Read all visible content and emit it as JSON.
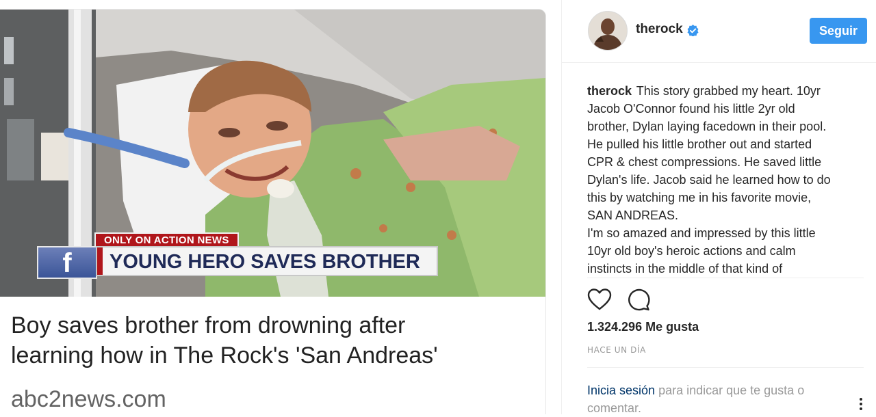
{
  "media": {
    "video_banner_tag": "ONLY ON ACTION NEWS",
    "video_banner_logo": "f",
    "video_banner_headline": "YOUNG HERO SAVES BROTHER",
    "story_title": "Boy saves brother from drowning after\nlearning how in The Rock's 'San Andreas'",
    "story_source": "abc2news.com"
  },
  "post": {
    "username": "therock",
    "verified_icon": "verified-badge-icon",
    "follow_label": "Seguir",
    "caption_user": "therock",
    "caption_lines": [
      "This story grabbed my heart. 10yr",
      "Jacob O'Connor found his little 2yr old",
      "brother, Dylan laying facedown in their pool.",
      "He pulled his little brother out and started",
      "CPR & chest compressions. He saved little",
      "Dylan's life. Jacob said he learned how to do",
      "this by watching me in his favorite movie,",
      "SAN ANDREAS.",
      "I'm so amazed and impressed by this little",
      "10yr old boy's heroic actions and calm",
      "instincts in the middle of that kind of"
    ],
    "icons": {
      "like": "heart-icon",
      "comment": "comment-icon",
      "more": "more-options-icon"
    },
    "likes_text": "1.324.296 Me gusta",
    "timestamp": "HACE UN DÍA",
    "login_link": "Inicia sesión",
    "login_rest": " para indicar que te gusta o comentar."
  },
  "colors": {
    "follow_button": "#3897f0",
    "verified_badge": "#3897f0",
    "banner_red": "#b0161b",
    "banner_navy": "#1f2a57",
    "link": "#003569",
    "muted_text": "#999999"
  }
}
